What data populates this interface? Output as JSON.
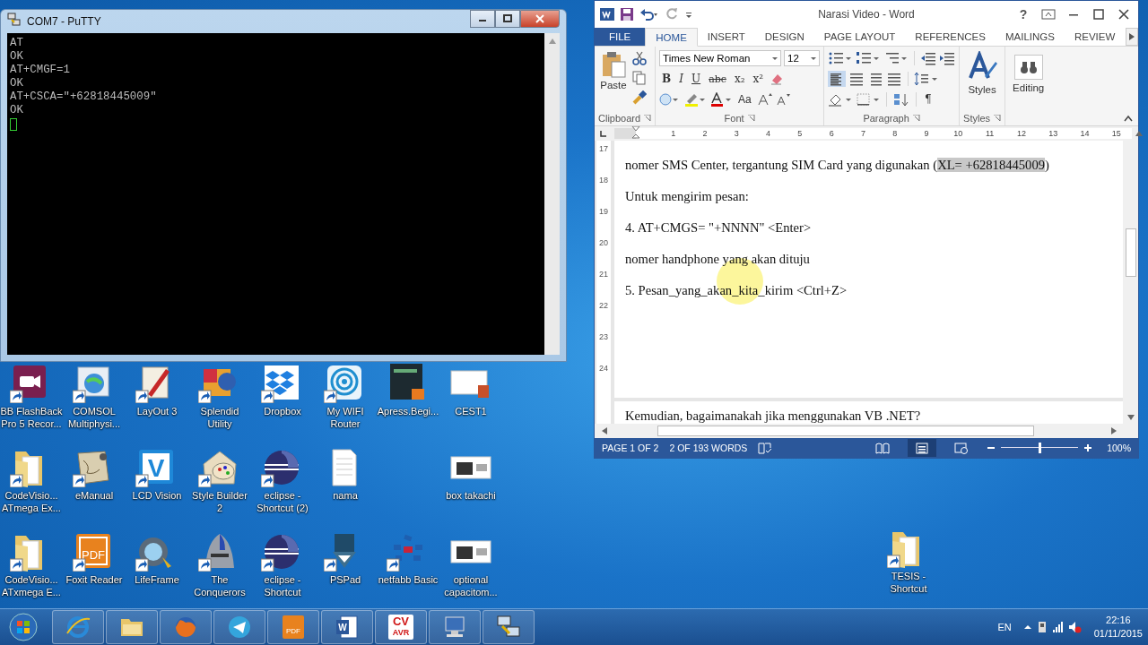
{
  "desktop": {
    "icon_rows": [
      [
        {
          "label": "BB FlashBack Pro 5 Recor...",
          "kind": "video-camera",
          "shortcut": true
        },
        {
          "label": "COMSOL Multiphysi...",
          "kind": "globe",
          "shortcut": true
        },
        {
          "label": "LayOut 3",
          "kind": "pencil",
          "shortcut": true
        },
        {
          "label": "Splendid Utility",
          "kind": "color-square",
          "shortcut": true
        },
        {
          "label": "Dropbox",
          "kind": "boxes",
          "shortcut": true
        },
        {
          "label": "My WIFI Router",
          "kind": "wifi",
          "shortcut": true
        },
        {
          "label": "Apress.Begi...",
          "kind": "book",
          "shortcut": false
        },
        {
          "label": "CEST1",
          "kind": "slide",
          "shortcut": false
        }
      ],
      [
        {
          "label": "CodeVisio... ATmega Ex...",
          "kind": "folder",
          "shortcut": true
        },
        {
          "label": "eManual",
          "kind": "manual",
          "shortcut": true
        },
        {
          "label": "LCD Vision",
          "kind": "v-tile",
          "glyph": "V",
          "shortcut": true
        },
        {
          "label": "Style Builder 2",
          "kind": "palette",
          "shortcut": true
        },
        {
          "label": "eclipse - Shortcut (2)",
          "kind": "sphere",
          "shortcut": true
        },
        {
          "label": "nama",
          "kind": "document",
          "shortcut": false
        },
        {
          "kind": "empty"
        },
        {
          "label": "box takachi",
          "kind": "thumbnail",
          "shortcut": false
        }
      ],
      [
        {
          "label": "CodeVisio... ATxmega E...",
          "kind": "folder",
          "shortcut": true
        },
        {
          "label": "Foxit Reader",
          "kind": "pdf-tile",
          "glyph": "PDF",
          "shortcut": true
        },
        {
          "label": "LifeFrame",
          "kind": "lens",
          "shortcut": true
        },
        {
          "label": "The Conquerors",
          "kind": "helmet",
          "shortcut": true
        },
        {
          "label": "eclipse - Shortcut",
          "kind": "sphere",
          "shortcut": true
        },
        {
          "label": "PSPad",
          "kind": "pen-nib",
          "shortcut": true
        },
        {
          "label": "netfabb Basic",
          "kind": "dots",
          "shortcut": true
        },
        {
          "label": "optional capacitom...",
          "kind": "thumbnail",
          "shortcut": false
        }
      ]
    ],
    "extra_icons": [
      {
        "label": "TESIS - Shortcut",
        "kind": "folder",
        "shortcut": true
      }
    ]
  },
  "putty": {
    "title": "COM7 - PuTTY",
    "lines": [
      "AT",
      "OK",
      "AT+CMGF=1",
      "OK",
      "AT+CSCA=\"+62818445009\"",
      "OK"
    ]
  },
  "word": {
    "title": "Narasi Video - Word",
    "help": "?",
    "tabs": [
      {
        "label": "FILE",
        "kind": "file",
        "selected": false
      },
      {
        "label": "HOME",
        "kind": "tab",
        "selected": true
      },
      {
        "label": "INSERT",
        "kind": "tab",
        "selected": false
      },
      {
        "label": "DESIGN",
        "kind": "tab",
        "selected": false
      },
      {
        "label": "PAGE LAYOUT",
        "kind": "tab",
        "selected": false
      },
      {
        "label": "REFERENCES",
        "kind": "tab",
        "selected": false
      },
      {
        "label": "MAILINGS",
        "kind": "tab",
        "selected": false
      },
      {
        "label": "REVIEW",
        "kind": "tab",
        "selected": false
      }
    ],
    "ribbon": {
      "clipboard": {
        "label": "Clipboard",
        "paste": "Paste"
      },
      "font": {
        "label": "Font",
        "font_name": "Times New Roman",
        "font_size": "12",
        "format_buttons": [
          "B",
          "I",
          "U",
          "abc",
          "x₂",
          "x²"
        ],
        "case_button": "Aa"
      },
      "paragraph": {
        "label": "Paragraph",
        "pilcrow": "¶"
      },
      "styles": {
        "label": "Styles",
        "button": "Styles"
      },
      "editing": {
        "button": "Editing"
      }
    },
    "ruler": [
      "1",
      "2",
      "3",
      "4",
      "5",
      "6",
      "7",
      "8",
      "9",
      "10",
      "11",
      "12",
      "13",
      "14",
      "15"
    ],
    "vertical_ruler": [
      "17",
      "18",
      "19",
      "20",
      "21",
      "22",
      "23",
      "24"
    ],
    "paragraphs": [
      {
        "segments": [
          {
            "text": "nomer SMS Center, tergantung SIM Card yang digunakan (",
            "selected": false
          },
          {
            "text": "XL= +62818445009",
            "selected": true
          },
          {
            "text": ")",
            "selected": false
          }
        ]
      },
      {
        "segments": [
          {
            "text": "Untuk mengirim pesan:",
            "selected": false
          }
        ]
      },
      {
        "segments": [
          {
            "text": "4. AT+CMGS= \"+NNNN\" <Enter>",
            "selected": false
          }
        ]
      },
      {
        "segments": [
          {
            "text": "nomer handphone yang akan dituju",
            "selected": false
          }
        ]
      },
      {
        "segments": [
          {
            "text": "5. Pesan_yang_akan_kita_kirim <Ctrl+Z>",
            "selected": false
          }
        ]
      }
    ],
    "next_page_paragraph": "Kemudian, bagaimanakah jika menggunakan VB .NET?",
    "status": {
      "page": "PAGE 1 OF 2",
      "words": "2 OF 193 WORDS",
      "views": [
        {
          "kind": "read",
          "selected": false
        },
        {
          "kind": "print",
          "selected": true
        },
        {
          "kind": "web",
          "selected": false
        }
      ],
      "zoom_slider": {
        "level": 0.5
      },
      "zoom": "100%"
    }
  },
  "taskbar": {
    "apps": [
      {
        "kind": "ie"
      },
      {
        "kind": "folder"
      },
      {
        "kind": "browser"
      },
      {
        "kind": "paper-plane"
      },
      {
        "kind": "pdf-tile",
        "glyph": "PDF"
      },
      {
        "kind": "w-tile",
        "glyph": "W"
      },
      {
        "kind": "text-tile",
        "lines": [
          "CV",
          "AVR"
        ]
      },
      {
        "kind": "computer"
      },
      {
        "kind": "computers"
      }
    ],
    "language": "EN",
    "time": "22:16",
    "date": "01/11/2015"
  }
}
